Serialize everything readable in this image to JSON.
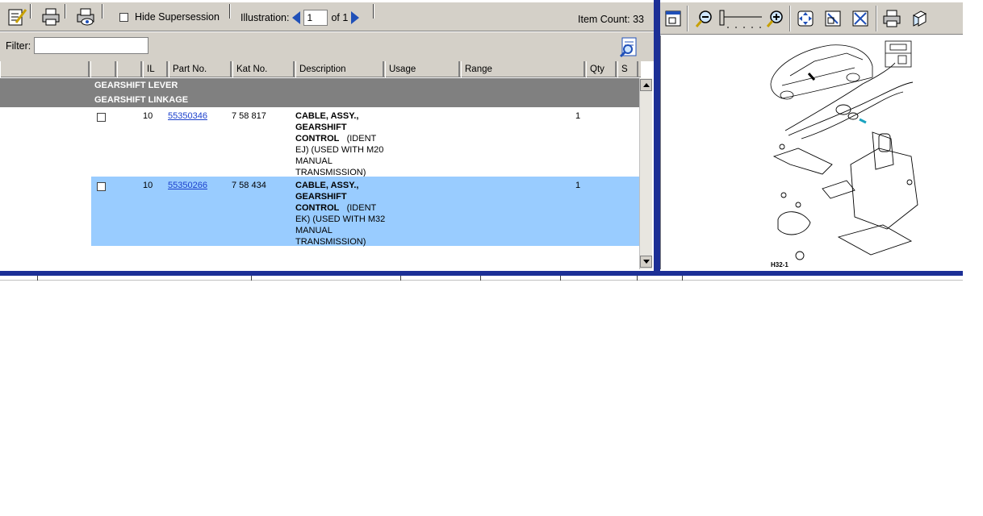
{
  "toolbar": {
    "hide_supersession_label": "Hide Supersession",
    "illustration_label": "Illustration:",
    "illustration_value": "1",
    "illustration_of": "of 1",
    "item_count": "Item Count: 33"
  },
  "filter": {
    "label": "Filter:",
    "value": ""
  },
  "columns": [
    "",
    "",
    "",
    "IL",
    "Part No.",
    "Kat No.",
    "Description",
    "Usage",
    "Range",
    "Qty",
    "S"
  ],
  "groups": [
    {
      "label": "GEARSHIFT LEVER"
    },
    {
      "label": "GEARSHIFT LINKAGE"
    }
  ],
  "rows": [
    {
      "il": "10",
      "part_no": "55350346",
      "kat_no": "7 58 817",
      "desc_line1": "CABLE, ASSY.,",
      "desc_line2": "GEARSHIFT",
      "desc_line3": "CONTROL",
      "desc_ident": "(IDENT",
      "desc_line4": "EJ) (USED WITH M20",
      "desc_line5": "MANUAL",
      "desc_line6": "TRANSMISSION)",
      "qty": "1",
      "selected": false
    },
    {
      "il": "10",
      "part_no": "55350266",
      "kat_no": "7 58 434",
      "desc_line1": "CABLE, ASSY.,",
      "desc_line2": "GEARSHIFT",
      "desc_line3": "CONTROL",
      "desc_ident": "(IDENT",
      "desc_line4": "EK) (USED WITH M32",
      "desc_line5": "MANUAL",
      "desc_line6": "TRANSMISSION)",
      "qty": "1",
      "selected": true
    }
  ],
  "illustration": {
    "caption": "H32-1"
  },
  "colors": {
    "toolbar_bg": "#d4d0c8",
    "group_bg": "#808080",
    "selected_row": "#99ccff",
    "divider": "#1c2f96",
    "link": "#1a3fcc"
  }
}
